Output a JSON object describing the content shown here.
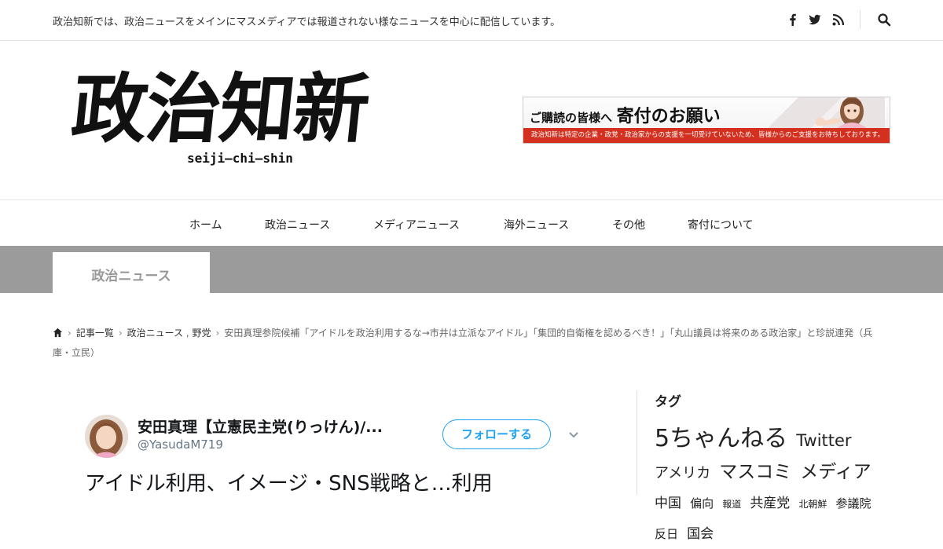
{
  "header": {
    "tagline": "政治知新では、政治ニュースをメインにマスメディアでは報道されない様なニュースを中心に配信しています。",
    "social_icons": [
      "facebook-icon",
      "twitter-icon",
      "rss-icon"
    ],
    "search_icon": "search-icon"
  },
  "logo": {
    "text": "政治知新",
    "subtext": "seiji—chi—shin"
  },
  "banner": {
    "lead": "ご購読の皆様へ",
    "headline": "寄付のお願い",
    "note": "政治知新は特定の企業・政党・政治家からの支援を一切受けていないため、皆様からのご支援をお待ちしております。"
  },
  "nav": {
    "items": [
      "ホーム",
      "政治ニュース",
      "メディアニュース",
      "海外ニュース",
      "その他",
      "寄付について"
    ]
  },
  "category": {
    "label": "政治ニュース"
  },
  "breadcrumb": {
    "home_icon": "home-icon",
    "articles": "記事一覧",
    "category": "政治ニュース",
    "category_sep": " , ",
    "subcategory": "野党",
    "current": "安田真理参院候補「アイドルを政治利用するな→市井は立派なアイドル」「集団的自衛権を認めるべき！」「丸山議員は将来のある政治家」と珍説連発（兵庫・立民）"
  },
  "tweet": {
    "name": "安田真理【立憲民主党(りっけん)/...",
    "handle": "@YasudaM719",
    "follow_label": "フォローする",
    "body": "アイドル利用、イメージ・SNS戦略と…利用"
  },
  "sidebar": {
    "title": "タグ",
    "tags": [
      {
        "label": "5ちゃんねる",
        "size": 30
      },
      {
        "label": "Twitter",
        "size": 21
      },
      {
        "label": "アメリカ",
        "size": 18
      },
      {
        "label": "マスコミ",
        "size": 23
      },
      {
        "label": "メディア",
        "size": 23
      },
      {
        "label": "中国",
        "size": 17
      },
      {
        "label": "偏向",
        "size": 15
      },
      {
        "label": "報道",
        "size": 12
      },
      {
        "label": "共産党",
        "size": 17
      },
      {
        "label": "北朝鮮",
        "size": 12
      },
      {
        "label": "参議院",
        "size": 15
      },
      {
        "label": "反日",
        "size": 15
      },
      {
        "label": "国会",
        "size": 17
      }
    ]
  },
  "colors": {
    "category_band": "#9b9b9b",
    "banner_strip": "#d4301f",
    "twitter_blue": "#1da1f2"
  }
}
